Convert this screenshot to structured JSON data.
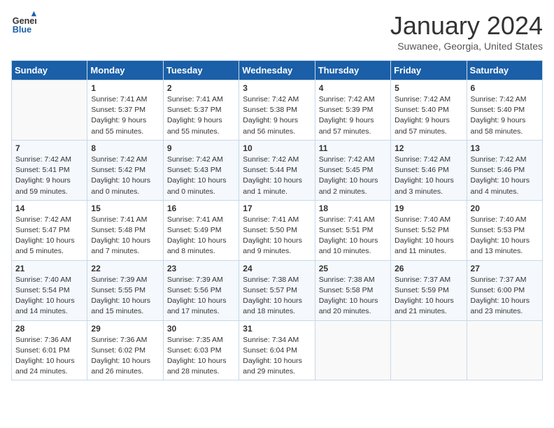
{
  "header": {
    "logo_line1": "General",
    "logo_line2": "Blue",
    "month": "January 2024",
    "location": "Suwanee, Georgia, United States"
  },
  "days_of_week": [
    "Sunday",
    "Monday",
    "Tuesday",
    "Wednesday",
    "Thursday",
    "Friday",
    "Saturday"
  ],
  "weeks": [
    [
      {
        "day": "",
        "sunrise": "",
        "sunset": "",
        "daylight": ""
      },
      {
        "day": "1",
        "sunrise": "Sunrise: 7:41 AM",
        "sunset": "Sunset: 5:37 PM",
        "daylight": "Daylight: 9 hours and 55 minutes."
      },
      {
        "day": "2",
        "sunrise": "Sunrise: 7:41 AM",
        "sunset": "Sunset: 5:37 PM",
        "daylight": "Daylight: 9 hours and 55 minutes."
      },
      {
        "day": "3",
        "sunrise": "Sunrise: 7:42 AM",
        "sunset": "Sunset: 5:38 PM",
        "daylight": "Daylight: 9 hours and 56 minutes."
      },
      {
        "day": "4",
        "sunrise": "Sunrise: 7:42 AM",
        "sunset": "Sunset: 5:39 PM",
        "daylight": "Daylight: 9 hours and 57 minutes."
      },
      {
        "day": "5",
        "sunrise": "Sunrise: 7:42 AM",
        "sunset": "Sunset: 5:40 PM",
        "daylight": "Daylight: 9 hours and 57 minutes."
      },
      {
        "day": "6",
        "sunrise": "Sunrise: 7:42 AM",
        "sunset": "Sunset: 5:40 PM",
        "daylight": "Daylight: 9 hours and 58 minutes."
      }
    ],
    [
      {
        "day": "7",
        "sunrise": "Sunrise: 7:42 AM",
        "sunset": "Sunset: 5:41 PM",
        "daylight": "Daylight: 9 hours and 59 minutes."
      },
      {
        "day": "8",
        "sunrise": "Sunrise: 7:42 AM",
        "sunset": "Sunset: 5:42 PM",
        "daylight": "Daylight: 10 hours and 0 minutes."
      },
      {
        "day": "9",
        "sunrise": "Sunrise: 7:42 AM",
        "sunset": "Sunset: 5:43 PM",
        "daylight": "Daylight: 10 hours and 0 minutes."
      },
      {
        "day": "10",
        "sunrise": "Sunrise: 7:42 AM",
        "sunset": "Sunset: 5:44 PM",
        "daylight": "Daylight: 10 hours and 1 minute."
      },
      {
        "day": "11",
        "sunrise": "Sunrise: 7:42 AM",
        "sunset": "Sunset: 5:45 PM",
        "daylight": "Daylight: 10 hours and 2 minutes."
      },
      {
        "day": "12",
        "sunrise": "Sunrise: 7:42 AM",
        "sunset": "Sunset: 5:46 PM",
        "daylight": "Daylight: 10 hours and 3 minutes."
      },
      {
        "day": "13",
        "sunrise": "Sunrise: 7:42 AM",
        "sunset": "Sunset: 5:46 PM",
        "daylight": "Daylight: 10 hours and 4 minutes."
      }
    ],
    [
      {
        "day": "14",
        "sunrise": "Sunrise: 7:42 AM",
        "sunset": "Sunset: 5:47 PM",
        "daylight": "Daylight: 10 hours and 5 minutes."
      },
      {
        "day": "15",
        "sunrise": "Sunrise: 7:41 AM",
        "sunset": "Sunset: 5:48 PM",
        "daylight": "Daylight: 10 hours and 7 minutes."
      },
      {
        "day": "16",
        "sunrise": "Sunrise: 7:41 AM",
        "sunset": "Sunset: 5:49 PM",
        "daylight": "Daylight: 10 hours and 8 minutes."
      },
      {
        "day": "17",
        "sunrise": "Sunrise: 7:41 AM",
        "sunset": "Sunset: 5:50 PM",
        "daylight": "Daylight: 10 hours and 9 minutes."
      },
      {
        "day": "18",
        "sunrise": "Sunrise: 7:41 AM",
        "sunset": "Sunset: 5:51 PM",
        "daylight": "Daylight: 10 hours and 10 minutes."
      },
      {
        "day": "19",
        "sunrise": "Sunrise: 7:40 AM",
        "sunset": "Sunset: 5:52 PM",
        "daylight": "Daylight: 10 hours and 11 minutes."
      },
      {
        "day": "20",
        "sunrise": "Sunrise: 7:40 AM",
        "sunset": "Sunset: 5:53 PM",
        "daylight": "Daylight: 10 hours and 13 minutes."
      }
    ],
    [
      {
        "day": "21",
        "sunrise": "Sunrise: 7:40 AM",
        "sunset": "Sunset: 5:54 PM",
        "daylight": "Daylight: 10 hours and 14 minutes."
      },
      {
        "day": "22",
        "sunrise": "Sunrise: 7:39 AM",
        "sunset": "Sunset: 5:55 PM",
        "daylight": "Daylight: 10 hours and 15 minutes."
      },
      {
        "day": "23",
        "sunrise": "Sunrise: 7:39 AM",
        "sunset": "Sunset: 5:56 PM",
        "daylight": "Daylight: 10 hours and 17 minutes."
      },
      {
        "day": "24",
        "sunrise": "Sunrise: 7:38 AM",
        "sunset": "Sunset: 5:57 PM",
        "daylight": "Daylight: 10 hours and 18 minutes."
      },
      {
        "day": "25",
        "sunrise": "Sunrise: 7:38 AM",
        "sunset": "Sunset: 5:58 PM",
        "daylight": "Daylight: 10 hours and 20 minutes."
      },
      {
        "day": "26",
        "sunrise": "Sunrise: 7:37 AM",
        "sunset": "Sunset: 5:59 PM",
        "daylight": "Daylight: 10 hours and 21 minutes."
      },
      {
        "day": "27",
        "sunrise": "Sunrise: 7:37 AM",
        "sunset": "Sunset: 6:00 PM",
        "daylight": "Daylight: 10 hours and 23 minutes."
      }
    ],
    [
      {
        "day": "28",
        "sunrise": "Sunrise: 7:36 AM",
        "sunset": "Sunset: 6:01 PM",
        "daylight": "Daylight: 10 hours and 24 minutes."
      },
      {
        "day": "29",
        "sunrise": "Sunrise: 7:36 AM",
        "sunset": "Sunset: 6:02 PM",
        "daylight": "Daylight: 10 hours and 26 minutes."
      },
      {
        "day": "30",
        "sunrise": "Sunrise: 7:35 AM",
        "sunset": "Sunset: 6:03 PM",
        "daylight": "Daylight: 10 hours and 28 minutes."
      },
      {
        "day": "31",
        "sunrise": "Sunrise: 7:34 AM",
        "sunset": "Sunset: 6:04 PM",
        "daylight": "Daylight: 10 hours and 29 minutes."
      },
      {
        "day": "",
        "sunrise": "",
        "sunset": "",
        "daylight": ""
      },
      {
        "day": "",
        "sunrise": "",
        "sunset": "",
        "daylight": ""
      },
      {
        "day": "",
        "sunrise": "",
        "sunset": "",
        "daylight": ""
      }
    ]
  ]
}
